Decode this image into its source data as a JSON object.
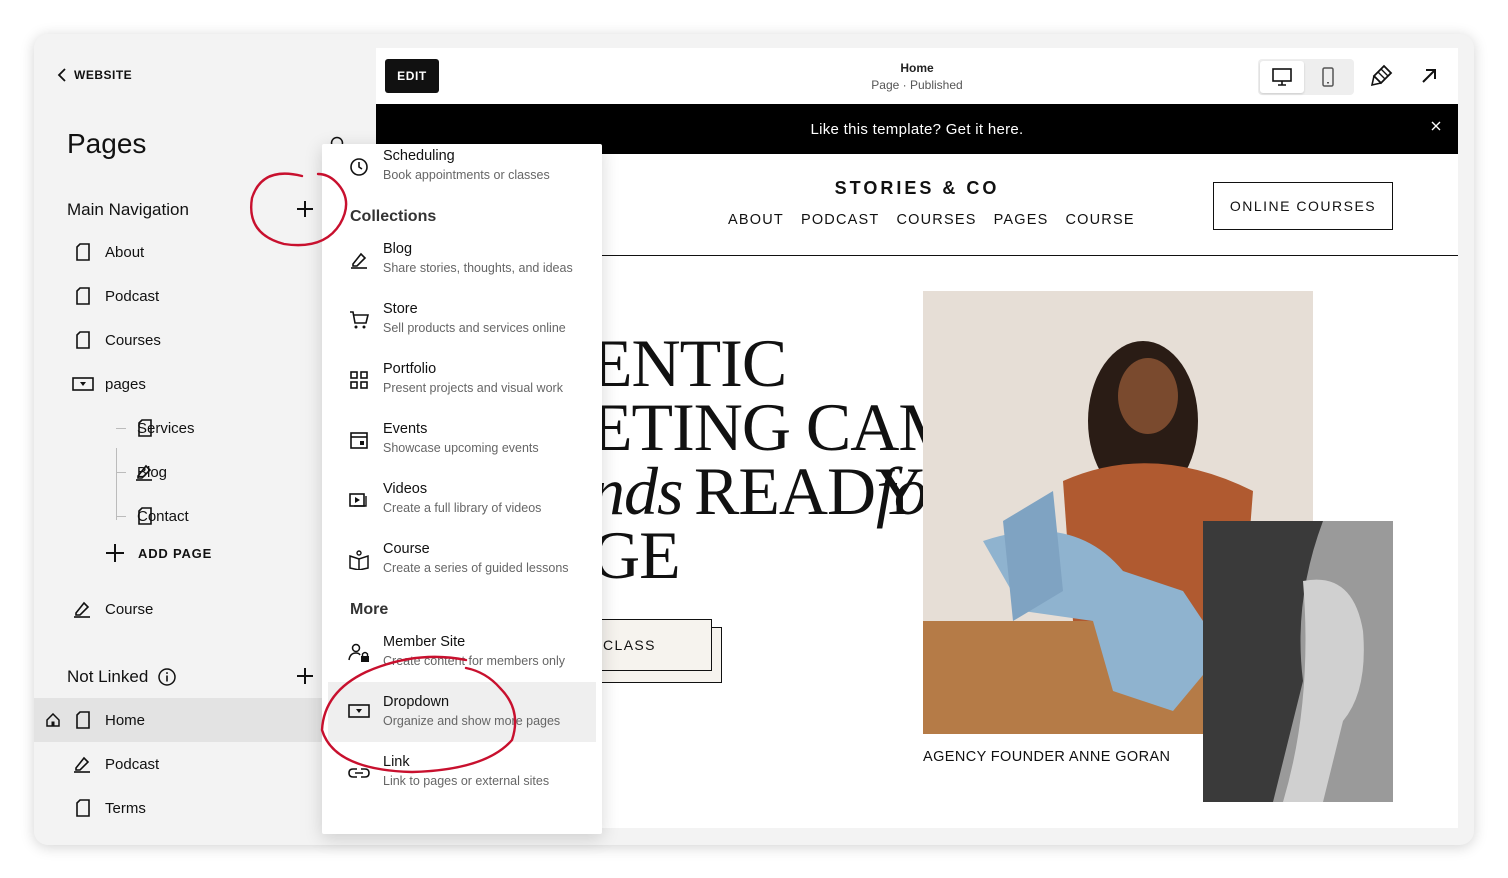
{
  "sidebar": {
    "back_label": "WEBSITE",
    "title": "Pages",
    "main_nav_heading": "Main Navigation",
    "main_nav_items": [
      {
        "label": "About",
        "icon": "page-icon"
      },
      {
        "label": "Podcast",
        "icon": "page-icon"
      },
      {
        "label": "Courses",
        "icon": "page-icon"
      },
      {
        "label": "pages",
        "icon": "dropdown-folder-icon"
      }
    ],
    "sub_items": [
      {
        "label": "Services",
        "icon": "page-icon"
      },
      {
        "label": "Blog",
        "icon": "blog-icon"
      },
      {
        "label": "Contact",
        "icon": "page-icon"
      }
    ],
    "add_page_label": "ADD PAGE",
    "course_item": {
      "label": "Course",
      "icon": "blog-icon"
    },
    "not_linked_heading": "Not Linked",
    "not_linked_items": [
      {
        "label": "Home",
        "icon": "page-icon",
        "active": true
      },
      {
        "label": "Podcast",
        "icon": "blog-icon"
      },
      {
        "label": "Terms",
        "icon": "page-icon"
      }
    ]
  },
  "topbar": {
    "edit_label": "EDIT",
    "page_name": "Home",
    "page_status": "Page · Published"
  },
  "announcement": {
    "text": "Like this template? Get it here."
  },
  "site": {
    "brand": "STORIES & CO",
    "nav": [
      "ABOUT",
      "PODCAST",
      "COURSES",
      "PAGES",
      "COURSE"
    ],
    "cta": "ONLINE COURSES",
    "hero_lines": [
      "ENTIC",
      "ETING CAMPAIGNS",
      "nds",
      "READY",
      "for",
      "GE"
    ],
    "class_button": "CLASS",
    "photo_caption": "AGENCY FOUNDER ANNE GORAN"
  },
  "menu": {
    "top_item": {
      "title": "Scheduling",
      "desc": "Book appointments or classes",
      "icon": "clock-icon"
    },
    "collections_heading": "Collections",
    "collections": [
      {
        "title": "Blog",
        "desc": "Share stories, thoughts, and ideas",
        "icon": "blog-icon"
      },
      {
        "title": "Store",
        "desc": "Sell products and services online",
        "icon": "cart-icon"
      },
      {
        "title": "Portfolio",
        "desc": "Present projects and visual work",
        "icon": "grid-icon"
      },
      {
        "title": "Events",
        "desc": "Showcase upcoming events",
        "icon": "calendar-icon"
      },
      {
        "title": "Videos",
        "desc": "Create a full library of videos",
        "icon": "video-icon"
      },
      {
        "title": "Course",
        "desc": "Create a series of guided lessons",
        "icon": "book-icon"
      }
    ],
    "more_heading": "More",
    "more": [
      {
        "title": "Member Site",
        "desc": "Create content for members only",
        "icon": "member-lock-icon"
      },
      {
        "title": "Dropdown",
        "desc": "Organize and show more pages",
        "icon": "dropdown-folder-icon",
        "highlighted": true
      },
      {
        "title": "Link",
        "desc": "Link to pages or external sites",
        "icon": "link-icon"
      }
    ]
  },
  "colors": {
    "accent_black": "#111111",
    "annotation_red": "#c8102e",
    "cream": "#f6f3ee"
  }
}
